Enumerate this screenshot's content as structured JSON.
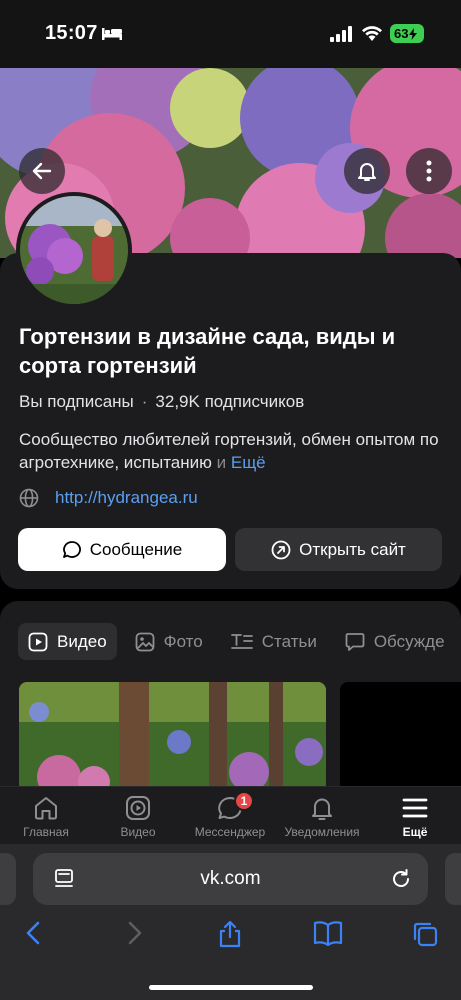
{
  "status_bar": {
    "time": "15:07",
    "battery": "63",
    "icons": [
      "bed-icon",
      "cellular-signal-icon",
      "wifi-icon",
      "battery-charging-icon"
    ]
  },
  "header": {
    "icons": [
      "back-arrow-icon",
      "bell-icon",
      "more-vertical-icon"
    ]
  },
  "community": {
    "title": "Гортензии в дизайне сада, виды и сорта гортензий",
    "subscribed": "Вы подписаны",
    "separator": "·",
    "subscribers": "32,9K подписчиков",
    "description": "Сообщество любителей гортензий, обмен опытом по агротехнике, испытанию",
    "description_faded": " и",
    "more": "Ещё",
    "website": "http://hydrangea.ru",
    "message_button": "Сообщение",
    "open_site_button": "Открыть сайт"
  },
  "tabs": [
    {
      "label": "Видео",
      "icon": "video-icon",
      "active": true
    },
    {
      "label": "Фото",
      "icon": "photo-icon",
      "active": false
    },
    {
      "label": "Статьи",
      "icon": "articles-icon",
      "active": false
    },
    {
      "label": "Обсужде",
      "icon": "discussion-icon",
      "active": false
    }
  ],
  "bottom_nav": [
    {
      "label": "Главная",
      "icon": "home-icon"
    },
    {
      "label": "Видео",
      "icon": "video-play-icon"
    },
    {
      "label": "Мессенджер",
      "icon": "chat-icon",
      "badge": "1"
    },
    {
      "label": "Уведомления",
      "icon": "bell-icon"
    },
    {
      "label": "Ещё",
      "icon": "hamburger-icon",
      "active": true
    }
  ],
  "browser": {
    "url": "vk.com",
    "toolbar_icons": [
      "back-icon",
      "forward-icon",
      "share-icon",
      "bookmarks-icon",
      "tabs-icon"
    ]
  },
  "colors": {
    "background": "#000000",
    "card": "#1c1c1e",
    "link": "#5b9ff0",
    "battery": "#3ecf52",
    "badge": "#e64646"
  }
}
